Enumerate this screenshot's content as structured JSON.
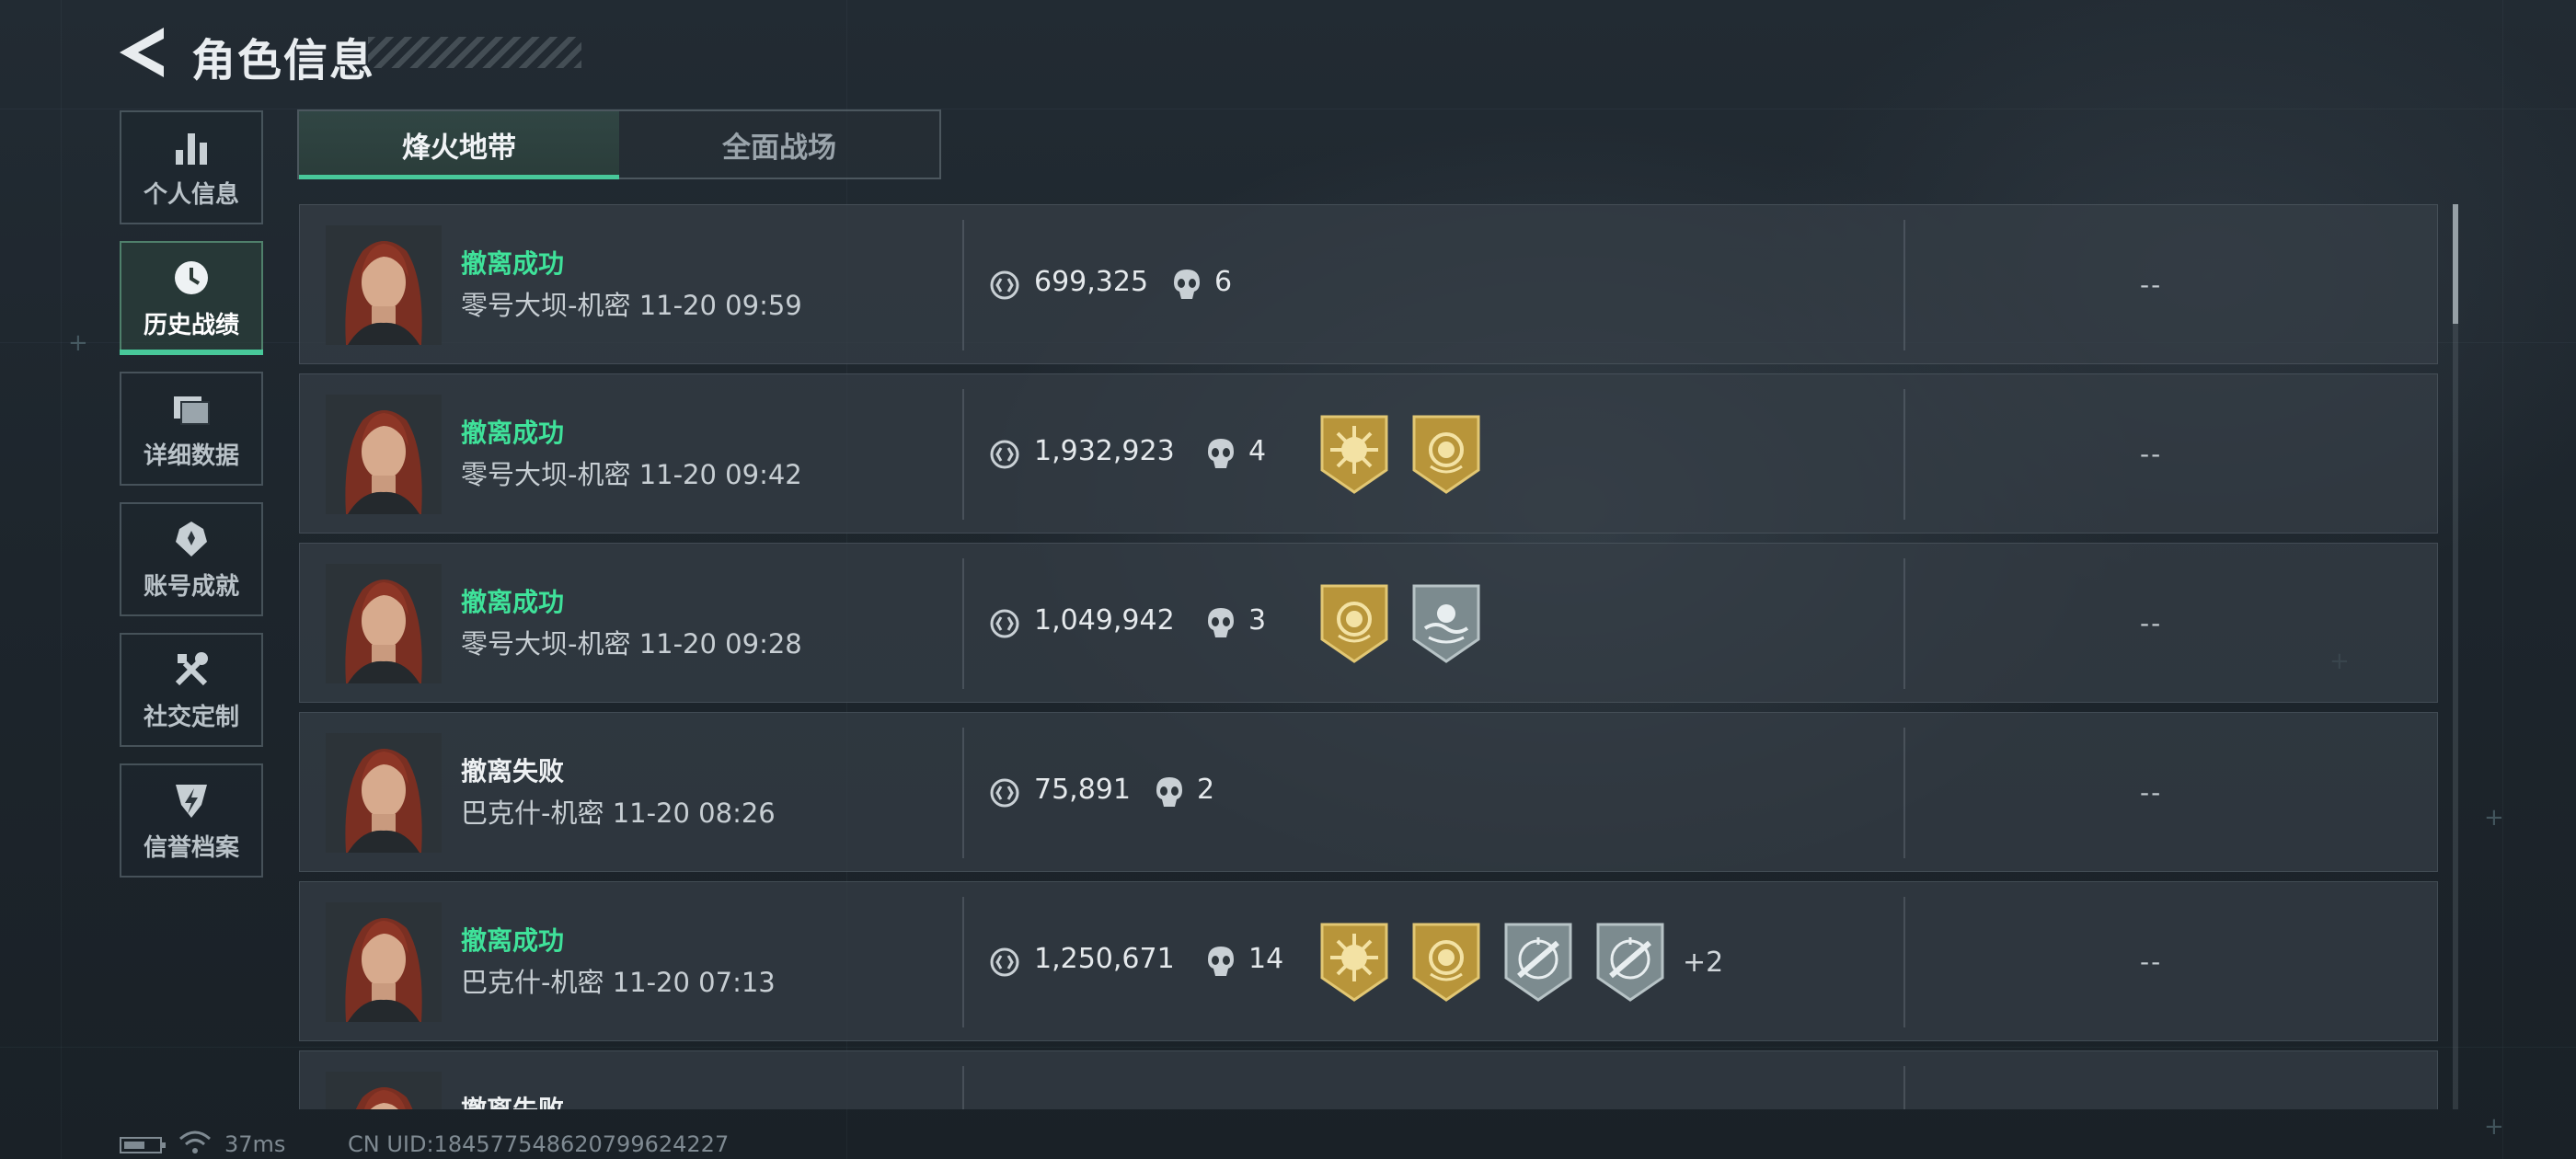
{
  "header": {
    "title": "角色信息"
  },
  "sidebar": {
    "items": [
      {
        "label": "个人信息",
        "icon": "bar-chart-icon",
        "active": false
      },
      {
        "label": "历史战绩",
        "icon": "history-clock-icon",
        "active": true
      },
      {
        "label": "详细数据",
        "icon": "cards-icon",
        "active": false
      },
      {
        "label": "账号成就",
        "icon": "achievement-icon",
        "active": false
      },
      {
        "label": "社交定制",
        "icon": "tools-icon",
        "active": false
      },
      {
        "label": "信誉档案",
        "icon": "credit-shield-icon",
        "active": false
      }
    ]
  },
  "tabs": [
    {
      "label": "烽火地带",
      "active": true
    },
    {
      "label": "全面战场",
      "active": false
    }
  ],
  "records": [
    {
      "status": "撤离成功",
      "status_type": "ok",
      "map": "零号大坝-机密",
      "time": "11-20 09:59",
      "value": "699,325",
      "kills": "6",
      "badges": [],
      "more": "",
      "extra": "--"
    },
    {
      "status": "撤离成功",
      "status_type": "ok",
      "map": "零号大坝-机密",
      "time": "11-20 09:42",
      "value": "1,932,923",
      "kills": "4",
      "badges": [
        "gold-sun-badge-icon",
        "gold-coin-badge-icon"
      ],
      "more": "",
      "extra": "--"
    },
    {
      "status": "撤离成功",
      "status_type": "ok",
      "map": "零号大坝-机密",
      "time": "11-20 09:28",
      "value": "1,049,942",
      "kills": "3",
      "badges": [
        "gold-coin-badge-icon",
        "silver-wave-badge-icon"
      ],
      "more": "",
      "extra": "--"
    },
    {
      "status": "撤离失败",
      "status_type": "fail",
      "map": "巴克什-机密",
      "time": "11-20 08:26",
      "value": "75,891",
      "kills": "2",
      "badges": [],
      "more": "",
      "extra": "--"
    },
    {
      "status": "撤离成功",
      "status_type": "ok",
      "map": "巴克什-机密",
      "time": "11-20 07:13",
      "value": "1,250,671",
      "kills": "14",
      "badges": [
        "gold-sun-badge-icon",
        "gold-coin-badge-icon",
        "silver-rifle-badge-icon",
        "silver-rifle-badge-icon"
      ],
      "more": "+2",
      "extra": "--"
    },
    {
      "status": "撤离失败",
      "status_type": "fail",
      "map": "",
      "time": "",
      "value": "",
      "kills": "",
      "badges": [],
      "more": "",
      "extra": ""
    }
  ],
  "footer": {
    "ping": "37ms",
    "uid": "CN UID:1845775486207996242​27"
  },
  "colors": {
    "accent": "#48c89a",
    "success": "#3fe29a",
    "badge_gold": "#b8953a",
    "badge_silver": "#7c8b8f"
  }
}
